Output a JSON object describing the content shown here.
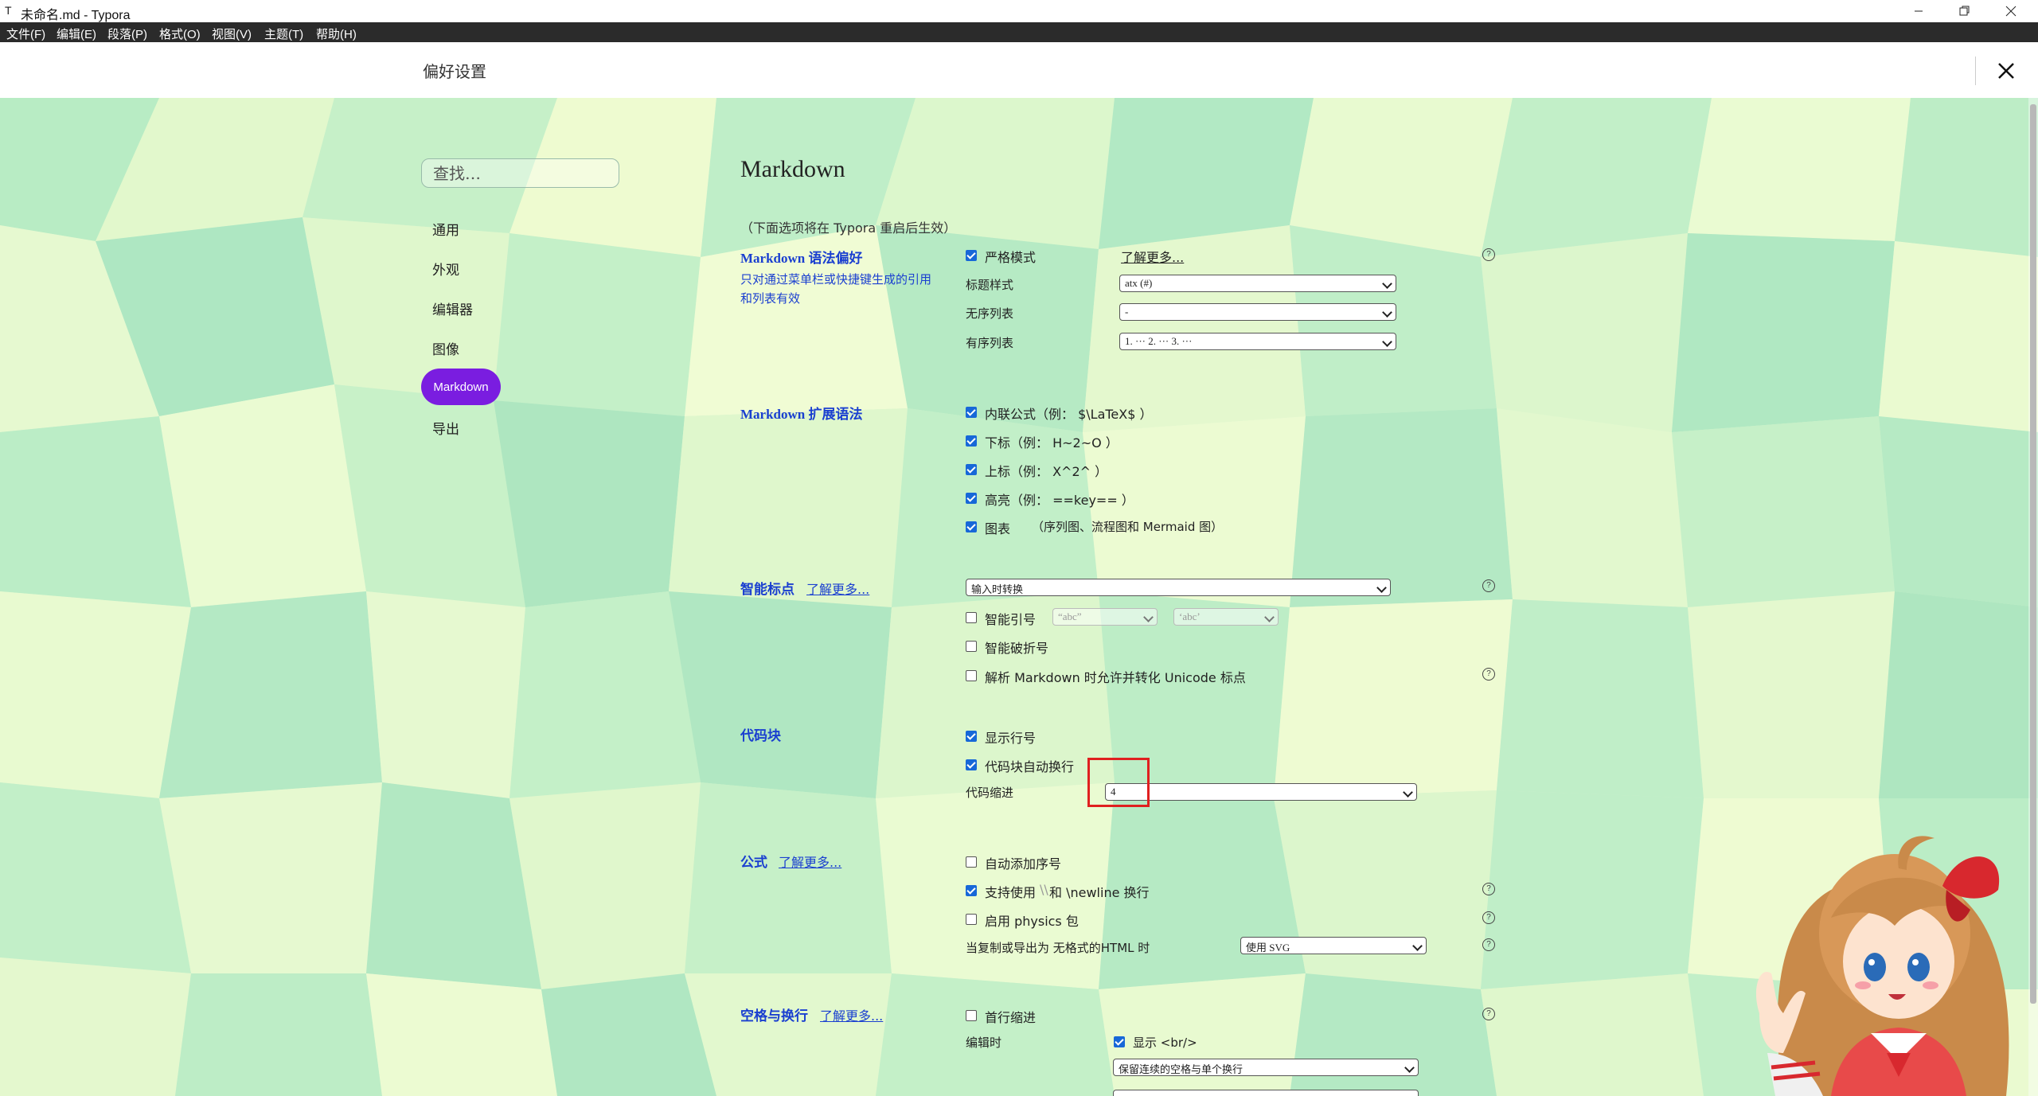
{
  "window": {
    "title": "未命名.md - Typora",
    "app_icon": "T"
  },
  "menu": [
    "文件(F)",
    "编辑(E)",
    "段落(P)",
    "格式(O)",
    "视图(V)",
    "主题(T)",
    "帮助(H)"
  ],
  "prefs": {
    "title": "偏好设置"
  },
  "sidebar": {
    "search_placeholder": "查找…",
    "items": [
      "通用",
      "外观",
      "编辑器",
      "图像",
      "Markdown",
      "导出"
    ]
  },
  "main": {
    "heading": "Markdown",
    "restart_note": "（下面选项将在 Typora 重启后生效）",
    "syntax": {
      "title": "Markdown 语法偏好",
      "desc": "只对通过菜单栏或快捷键生成的引用和列表有效",
      "strict_mode": "严格模式",
      "learn_more": "了解更多...",
      "heading_style_label": "标题样式",
      "heading_style_value": "atx (#)",
      "ul_label": "无序列表",
      "ul_value": "-",
      "ol_label": "有序列表",
      "ol_value": "1. ··· 2. ··· 3. ···"
    },
    "ext": {
      "title": "Markdown 扩展语法",
      "items": [
        "内联公式（例： $\\LaTeX$ ）",
        "下标（例： H~2~O ）",
        "上标（例： X^2^ ）",
        "高亮（例： ==key== ）",
        "图表"
      ],
      "diagram_note": "（序列图、流程图和 Mermaid 图）"
    },
    "smart": {
      "title": "智能标点",
      "learn_more": "了解更多...",
      "mode_value": "输入时转换",
      "smart_quotes": "智能引号",
      "dq_value": "“abc”",
      "sq_value": "‘abc’",
      "smart_dash": "智能破折号",
      "unicode": "解析 Markdown 时允许并转化 Unicode 标点"
    },
    "code": {
      "title": "代码块",
      "line_numbers": "显示行号",
      "wrap": "代码块自动换行",
      "indent_label": "代码缩进",
      "indent_value": "4"
    },
    "math": {
      "title": "公式",
      "learn_more": "了解更多...",
      "auto_number": "自动添加序号",
      "newline_pre": "支持使用",
      "newline_bs": "\\\\",
      "newline_post": "和 \\newline 换行",
      "physics": "启用 physics 包",
      "export_label": "当复制或导出为 无格式的HTML 时",
      "export_value": "使用 SVG"
    },
    "ws": {
      "title": "空格与换行",
      "learn_more": "了解更多...",
      "first_indent": "首行缩进",
      "editing_label": "编辑时",
      "show_br": "显示 <br/>",
      "preserve_value": "保留连续的空格与单个换行"
    }
  },
  "colors": {
    "accent": "#7a1de0",
    "link": "#1a3fd0",
    "checkbox": "#1768d8",
    "highlight_box": "#e02020"
  }
}
